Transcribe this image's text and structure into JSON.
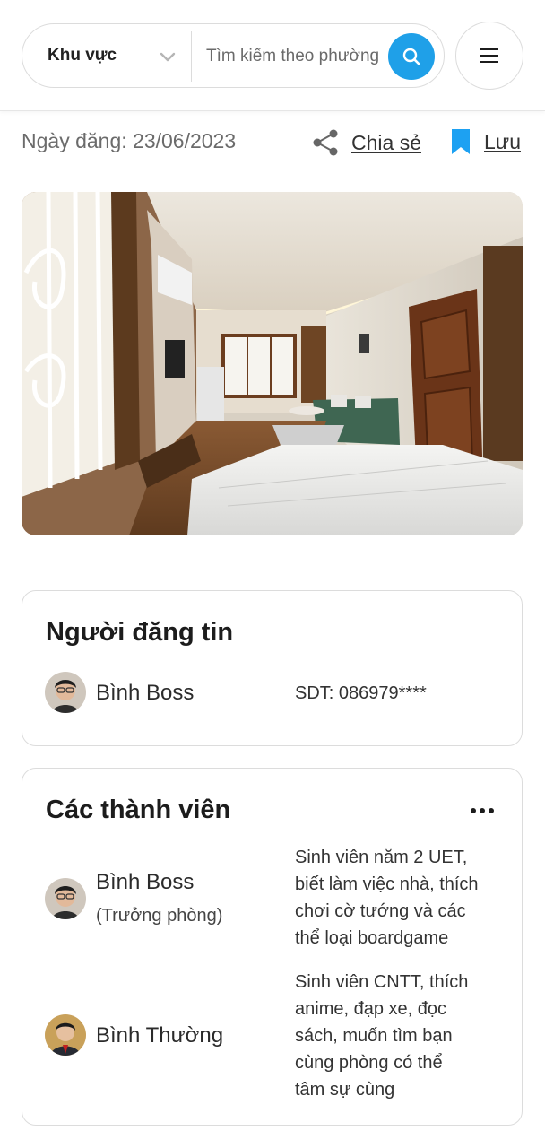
{
  "header": {
    "region_label": "Khu vực",
    "search_placeholder": "Tìm kiếm theo phường",
    "accent_color": "#1fa0e8"
  },
  "post": {
    "date_text": "Ngày đăng: 23/06/2023",
    "share_label": "Chia sẻ",
    "save_label": "Lưu",
    "icons": [
      "share-icon",
      "bookmark-icon"
    ]
  },
  "poster": {
    "title": "Người đăng tin",
    "name": "Bình Boss",
    "phone": "SDT: 086979****"
  },
  "members": {
    "title": "Các thành viên",
    "items": [
      {
        "name": "Bình Boss",
        "role": "(Trưởng phòng)",
        "desc_lines": [
          "Sinh viên năm 2 UET,",
          "biết làm việc nhà, thích",
          "chơi cờ tướng và các",
          "thể loại boardgame"
        ]
      },
      {
        "name": "Bình Thường",
        "role": "",
        "desc_lines": [
          "Sinh viên CNTT, thích",
          "anime, đạp xe, đọc",
          "sách, muốn tìm bạn",
          "cùng phòng có thể",
          "tâm sự cùng"
        ]
      }
    ]
  }
}
